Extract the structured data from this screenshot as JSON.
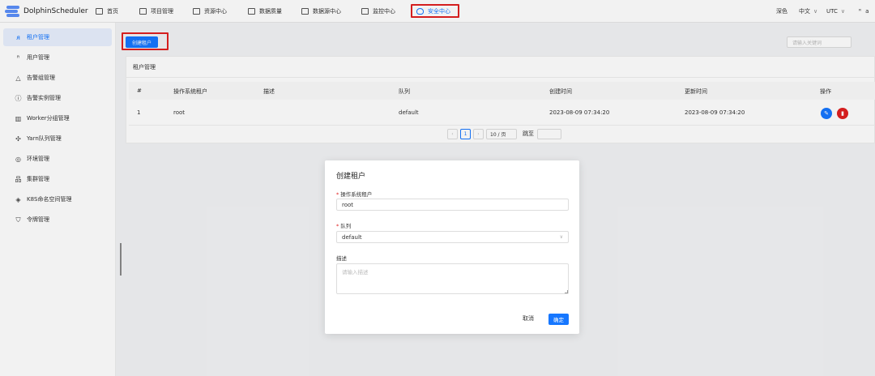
{
  "app": {
    "name": "DolphinScheduler"
  },
  "nav": {
    "items": [
      {
        "label": "首页",
        "icon": "home-icon"
      },
      {
        "label": "项目管理",
        "icon": "project-icon"
      },
      {
        "label": "资源中心",
        "icon": "folder-icon"
      },
      {
        "label": "数据质量",
        "icon": "data-quality-icon"
      },
      {
        "label": "数据源中心",
        "icon": "datasource-icon"
      },
      {
        "label": "监控中心",
        "icon": "monitor-icon"
      },
      {
        "label": "安全中心",
        "icon": "shield-icon",
        "active": true
      }
    ],
    "theme_label": "深色",
    "language": "中文",
    "timezone": "UTC",
    "user": "a"
  },
  "sidebar": {
    "items": [
      {
        "label": "租户管理",
        "icon": "tenant-icon",
        "active": true
      },
      {
        "label": "用户管理",
        "icon": "user-icon"
      },
      {
        "label": "告警组管理",
        "icon": "warning-icon"
      },
      {
        "label": "告警实例管理",
        "icon": "info-icon"
      },
      {
        "label": "Worker分组管理",
        "icon": "worker-group-icon"
      },
      {
        "label": "Yarn队列管理",
        "icon": "queue-icon"
      },
      {
        "label": "环境管理",
        "icon": "environment-icon"
      },
      {
        "label": "集群管理",
        "icon": "cluster-icon"
      },
      {
        "label": "K8S命名空间管理",
        "icon": "namespace-icon"
      },
      {
        "label": "令牌管理",
        "icon": "token-icon"
      }
    ]
  },
  "toolbar": {
    "create_label": "创建租户",
    "search_placeholder": "请输入关键词"
  },
  "table": {
    "title": "租户管理",
    "columns": [
      "#",
      "操作系统租户",
      "描述",
      "队列",
      "创建时间",
      "更新时间",
      "操作"
    ],
    "rows": [
      {
        "index": "1",
        "tenant": "root",
        "description": "",
        "queue": "default",
        "created": "2023-08-09 07:34:20",
        "updated": "2023-08-09 07:34:20"
      }
    ]
  },
  "pagination": {
    "current_page": "1",
    "page_size": "10 / 页",
    "jump_label": "跳至"
  },
  "modal": {
    "title": "创建租户",
    "tenant_label": "操作系统租户",
    "tenant_value": "root",
    "queue_label": "队列",
    "queue_value": "default",
    "description_label": "描述",
    "description_placeholder": "请输入描述",
    "cancel_label": "取消",
    "confirm_label": "确定"
  },
  "colors": {
    "primary": "#1677ff",
    "danger": "#e02020",
    "highlight_box": "#e02020"
  }
}
